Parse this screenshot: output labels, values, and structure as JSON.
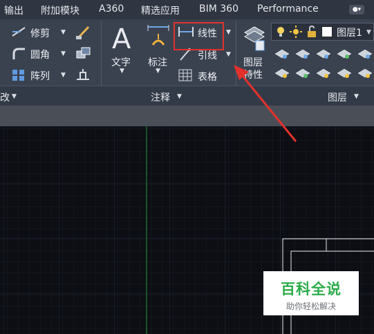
{
  "tabs": [
    {
      "label": "输出"
    },
    {
      "label": "附加模块"
    },
    {
      "label": "A360"
    },
    {
      "label": "精选应用"
    },
    {
      "label": "BIM 360"
    },
    {
      "label": "Performance"
    }
  ],
  "modify_panel": {
    "trim_label": "修剪",
    "fillet_label": "圆角",
    "array_label": "阵列",
    "title_fragment": "改"
  },
  "annotation_panel": {
    "text_label": "文字",
    "dimension_label": "标注",
    "linear_label": "线性",
    "leader_label": "引线",
    "table_label": "表格",
    "title": "注释"
  },
  "layers_panel": {
    "layer_properties_label_line1": "图层",
    "layer_properties_label_line2": "特性",
    "current_layer": "图层1",
    "title": "图层"
  },
  "watermark": {
    "title": "百科全说",
    "subtitle": "助你轻松解决"
  },
  "colors": {
    "highlight_box": "#e3312d",
    "arrow": "#e3312d",
    "axis_line": "#1f6b2a",
    "watermark_green": "#2bab4a"
  }
}
